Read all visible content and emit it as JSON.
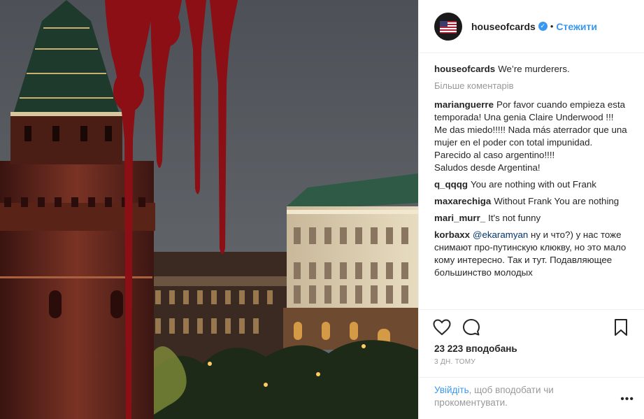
{
  "post": {
    "username": "houseofcards",
    "follow_label": "Стежити",
    "dot": "•",
    "caption_user": "houseofcards",
    "caption_text": "We’re murderers.",
    "more_comments": "Більше коментарів"
  },
  "comments": [
    {
      "user": "marianguerre",
      "text": "Por favor cuando empieza esta temporada! Una genia Claire Underwood !!! Me das miedo!!!!! Nada más aterrador que una mujer en el poder con total impunidad. Parecido al caso argentino!!!!",
      "extra": "Saludos desde Argentina!"
    },
    {
      "user": "q_qqqg",
      "text": "You are nothing with out Frank"
    },
    {
      "user": "maxarechiga",
      "text": "Without Frank You are nothing"
    },
    {
      "user": "mari_murr_",
      "text": "It's not funny"
    },
    {
      "user": "korbaxx",
      "mention": "@ekaramyan",
      "text": "ну и что?) у нас тоже снимают про-путинскую клюкву, но это мало кому интересно. Так и тут. Подавляющее большинство молодых"
    }
  ],
  "actions": {
    "likes": "23 223 вподобань",
    "time": "3 ДН. ТОМУ",
    "login_link": "Увійдіть",
    "login_text": ", щоб вподобати чи прокоментувати.",
    "more_glyph": "•••"
  },
  "icons": {
    "avatar": "house-of-cards-flag-icon",
    "verified": "verified-badge-icon",
    "like": "heart-icon",
    "comment": "comment-bubble-icon",
    "save": "bookmark-icon",
    "options": "more-options-icon"
  },
  "colors": {
    "link": "#3897f0",
    "muted": "#999999",
    "text": "#262626",
    "blood": "#8b0f14"
  }
}
